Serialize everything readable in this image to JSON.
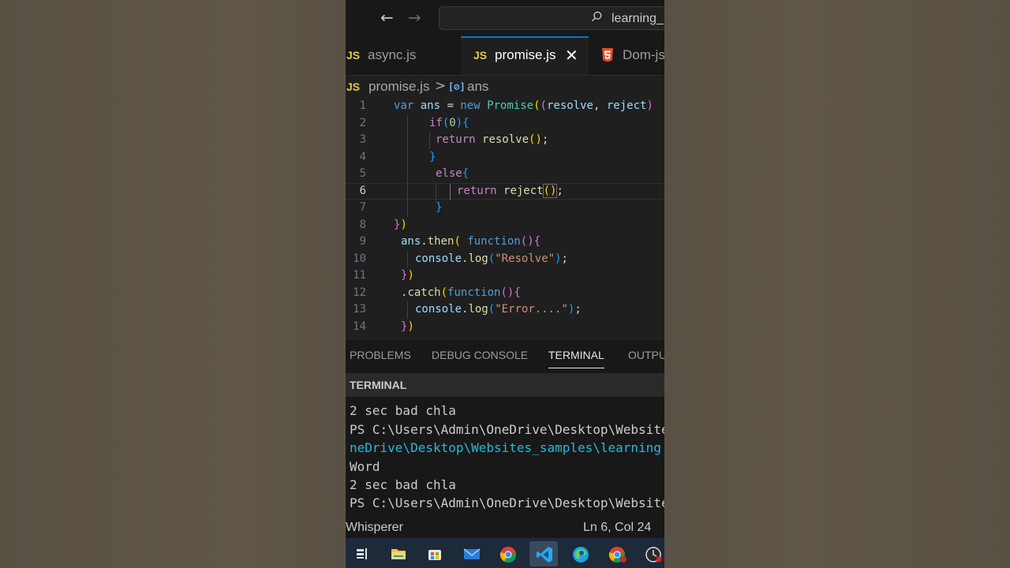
{
  "titlebar": {
    "search_text": "learning_"
  },
  "tabs": [
    {
      "icon": "JS",
      "label": "async.js"
    },
    {
      "icon": "JS",
      "label": "promise.js",
      "close": "✕"
    },
    {
      "icon": "html5-icon",
      "label": "Dom-js"
    }
  ],
  "breadcrumb": {
    "file_icon": "JS",
    "file": "promise.js",
    "separator": ">",
    "symbol_icon": "[⊘]",
    "symbol": "ans"
  },
  "editor": {
    "line_numbers": [
      "1",
      "2",
      "3",
      "4",
      "5",
      "6",
      "7",
      "8",
      "9",
      "10",
      "11",
      "12",
      "13",
      "14"
    ],
    "active_line": 6
  },
  "panel": {
    "tabs": [
      "PROBLEMS",
      "DEBUG CONSOLE",
      "TERMINAL",
      "OUTPUT"
    ],
    "active_tab": "TERMINAL",
    "header": "TERMINAL"
  },
  "terminal": {
    "lines": [
      "2 sec bad chla",
      "PS C:\\Users\\Admin\\OneDrive\\Desktop\\Websites_samples",
      "neDrive\\Desktop\\Websites_samples\\learning",
      "Word",
      "2 sec bad chla",
      "PS C:\\Users\\Admin\\OneDrive\\Desktop\\Websites_samples"
    ]
  },
  "statusbar": {
    "left": "Whisperer",
    "position": "Ln 6, Col 24"
  },
  "taskbar": {
    "items": [
      "task-view-icon",
      "file-explorer-icon",
      "store-icon",
      "mail-icon",
      "chrome-icon",
      "vscode-icon",
      "edge-icon",
      "chrome-profile-icon",
      "clock-icon"
    ]
  },
  "colors": {
    "accent": "#0078d4",
    "js_badge": "#e6c84a",
    "editor_bg": "#1f1f1f",
    "terminal_cyan": "#29b8db"
  }
}
